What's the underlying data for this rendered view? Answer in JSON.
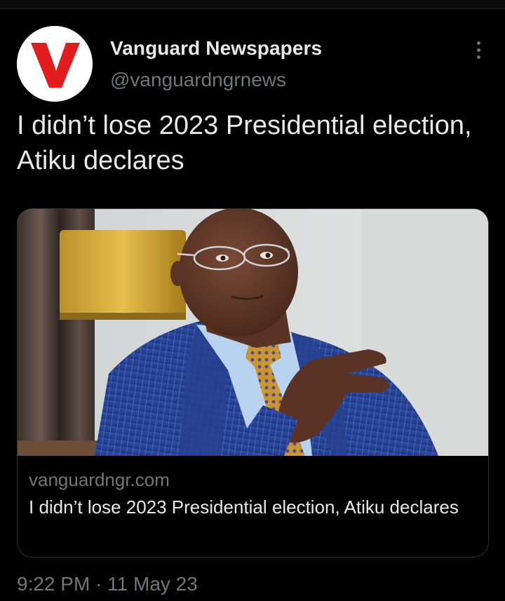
{
  "author": {
    "name": "Vanguard Newspapers",
    "handle": "@vanguardngrnews",
    "avatar_icon": "vanguard-v-logo",
    "avatar_color": "#e11d1d"
  },
  "tweet": {
    "text": "I didn’t lose 2023 Presidential election, Atiku declares"
  },
  "card": {
    "domain": "vanguardngr.com",
    "title": "I didn’t lose 2023 Presidential election, Atiku declares",
    "image_icon": "article-photo"
  },
  "timestamp": "9:22 PM · 11 May 23",
  "menu_icon": "more-vertical-icon",
  "colors": {
    "background": "#000000",
    "primary_text": "#e7e9ea",
    "secondary_text": "#71767b",
    "border": "#2f3336"
  }
}
